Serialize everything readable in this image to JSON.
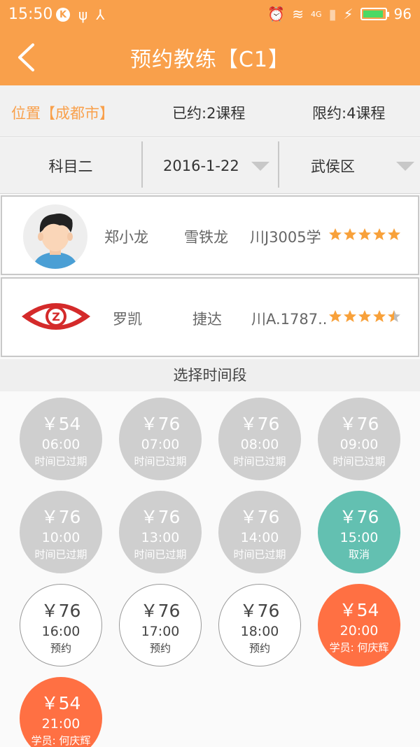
{
  "status_bar": {
    "time": "15:50",
    "k_badge": "K",
    "usb_icon": "ψ",
    "share_icon": "⅄",
    "alarm_icon": "⏰",
    "wifi_icon": "≋",
    "network_label": "4G",
    "signal_icon": "▮",
    "charging_icon": "⚡",
    "battery": "96"
  },
  "header": {
    "title": "预约教练【C1】"
  },
  "info": {
    "location": "位置【成都市】",
    "booked": "已约:2课程",
    "limit": "限约:4课程"
  },
  "filters": {
    "subject": "科目二",
    "date": "2016-1-22",
    "district": "武侯区"
  },
  "coaches": [
    {
      "name": "郑小龙",
      "car": "雪铁龙",
      "plate": "川J3005学",
      "rating": 5
    },
    {
      "name": "罗凯",
      "car": "捷达",
      "plate": "川A.1787..",
      "rating": 4.5
    }
  ],
  "logo_letter": "Z",
  "section_title": "选择时间段",
  "slots": [
    {
      "price": "￥54",
      "time": "06:00",
      "status": "时间已过期",
      "state": "expired"
    },
    {
      "price": "￥76",
      "time": "07:00",
      "status": "时间已过期",
      "state": "expired"
    },
    {
      "price": "￥76",
      "time": "08:00",
      "status": "时间已过期",
      "state": "expired"
    },
    {
      "price": "￥76",
      "time": "09:00",
      "status": "时间已过期",
      "state": "expired"
    },
    {
      "price": "￥76",
      "time": "10:00",
      "status": "时间已过期",
      "state": "expired"
    },
    {
      "price": "￥76",
      "time": "13:00",
      "status": "时间已过期",
      "state": "expired"
    },
    {
      "price": "￥76",
      "time": "14:00",
      "status": "时间已过期",
      "state": "expired"
    },
    {
      "price": "￥76",
      "time": "15:00",
      "status": "取消",
      "state": "cancel"
    },
    {
      "price": "￥76",
      "time": "16:00",
      "status": "预约",
      "state": "open"
    },
    {
      "price": "￥76",
      "time": "17:00",
      "status": "预约",
      "state": "open"
    },
    {
      "price": "￥76",
      "time": "18:00",
      "status": "预约",
      "state": "open"
    },
    {
      "price": "￥54",
      "time": "20:00",
      "status": "学员: 何庆辉",
      "state": "booked"
    },
    {
      "price": "￥54",
      "time": "21:00",
      "status": "学员: 何庆辉",
      "state": "booked"
    }
  ],
  "colors": {
    "accent": "#f9a04b",
    "expired": "#cfcfcf",
    "cancel": "#63c0b1",
    "booked": "#ff7043",
    "star": "#f8a13a"
  }
}
